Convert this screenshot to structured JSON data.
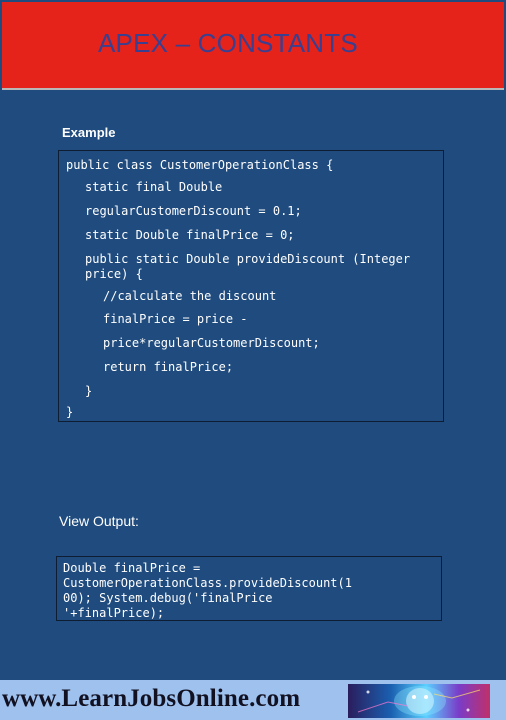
{
  "header": {
    "title": "APEX – CONSTANTS"
  },
  "example": {
    "label": "Example",
    "code_lines": [
      "public class CustomerOperationClass {",
      "static final Double",
      "regularCustomerDiscount = 0.1;",
      "static Double finalPrice = 0;",
      "public static Double provideDiscount (Integer",
      "price) {",
      "//calculate the discount",
      "finalPrice = price -",
      "price*regularCustomerDiscount;",
      "return finalPrice;",
      "}",
      "}"
    ]
  },
  "output": {
    "label": "View Output:",
    "code_lines": [
      "Double finalPrice =",
      "CustomerOperationClass.provideDiscount(1",
      "00);  System.debug('finalPrice",
      "'+finalPrice);"
    ]
  },
  "footer": {
    "url": "www.LearnJobsOnline.com",
    "colors": {
      "bar": "#9ec1ee"
    }
  },
  "colors": {
    "header_bg": "#e5231a",
    "slide_bg": "#1f4b7e",
    "title_text": "#3b3f8f"
  }
}
